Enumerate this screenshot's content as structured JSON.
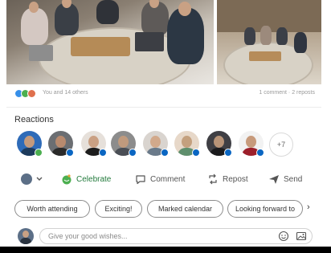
{
  "post": {
    "reaction_count_text": "You and 14 others",
    "comment_repost_text": "1 comment · 2 reposts"
  },
  "reactions": {
    "title": "Reactions",
    "more_label": "+7"
  },
  "actions": {
    "celebrate": "Celebrate",
    "comment": "Comment",
    "repost": "Repost",
    "send": "Send"
  },
  "suggestions": [
    "Worth attending",
    "Exciting!",
    "Marked calendar",
    "Looking forward to"
  ],
  "comment_box": {
    "placeholder": "Give your good wishes..."
  },
  "icons": {
    "reaction_like": "like-icon",
    "reaction_celebrate": "celebrate-icon",
    "reaction_love": "love-icon",
    "celebrate_action": "celebrate-icon",
    "comment_action": "comment-icon",
    "repost_action": "repost-icon",
    "send_action": "send-icon",
    "chevron": "chevron-right-icon",
    "emoji": "emoji-icon",
    "image": "image-icon"
  },
  "colors": {
    "celebrate_green": "#237a3c",
    "linkedin_blue": "#0a66c2",
    "love_red": "#df704d"
  }
}
